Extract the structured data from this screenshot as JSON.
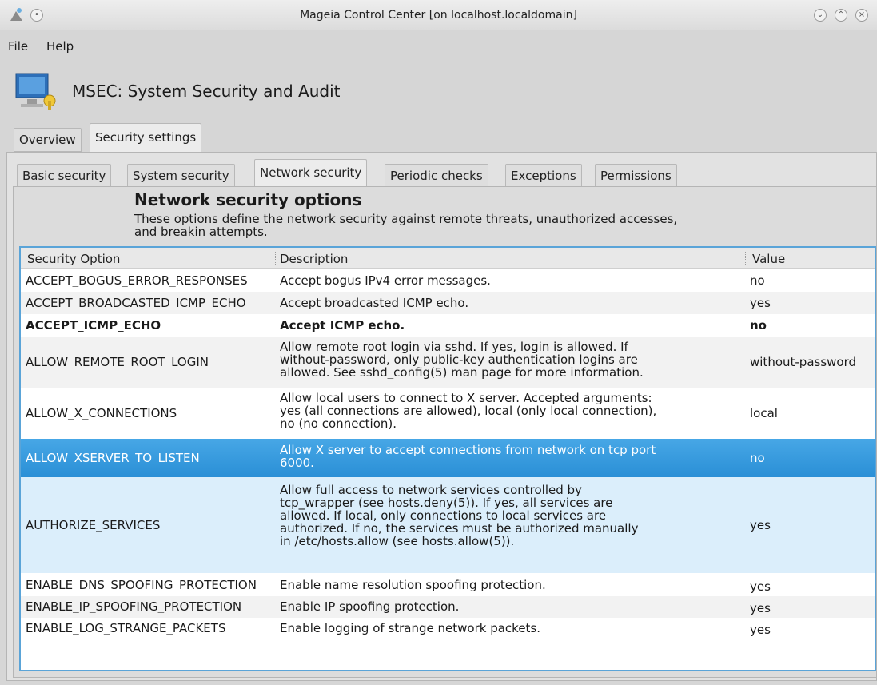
{
  "window": {
    "title": "Mageia Control Center  [on localhost.localdomain]"
  },
  "menu": {
    "file": "File",
    "help": "Help"
  },
  "app": {
    "title": "MSEC: System Security and Audit"
  },
  "top_tabs": [
    "Overview",
    "Security settings"
  ],
  "sub_tabs": [
    "Basic security",
    "System security",
    "Network security",
    "Periodic checks",
    "Exceptions",
    "Permissions"
  ],
  "section": {
    "title": "Network security options",
    "desc_line1": "These options define the network security against remote threats, unauthorized accesses,",
    "desc_line2": "and breakin attempts."
  },
  "table": {
    "headers": [
      "Security Option",
      "Description",
      "Value"
    ],
    "rows": [
      {
        "option": "ACCEPT_BOGUS_ERROR_RESPONSES",
        "desc": [
          "Accept bogus IPv4 error messages."
        ],
        "value": "no"
      },
      {
        "option": "ACCEPT_BROADCASTED_ICMP_ECHO",
        "desc": [
          "Accept broadcasted ICMP echo."
        ],
        "value": "yes"
      },
      {
        "option": "ACCEPT_ICMP_ECHO",
        "desc": [
          "Accept ICMP echo."
        ],
        "value": "no"
      },
      {
        "option": "ALLOW_REMOTE_ROOT_LOGIN",
        "desc": [
          "Allow remote root login via sshd. If yes, login is allowed. If",
          "without-password, only public-key authentication logins are",
          "allowed. See sshd_config(5) man page for more information."
        ],
        "value": "without-password"
      },
      {
        "option": "ALLOW_X_CONNECTIONS",
        "desc": [
          "Allow local users to connect to X server. Accepted arguments:",
          "yes (all connections are allowed), local (only local connection),",
          "no (no connection)."
        ],
        "value": "local"
      },
      {
        "option": "ALLOW_XSERVER_TO_LISTEN",
        "desc": [
          "Allow X server to accept connections from network on tcp port",
          "6000."
        ],
        "value": "no"
      },
      {
        "option": "AUTHORIZE_SERVICES",
        "desc": [
          "Allow full access to network services controlled by",
          "tcp_wrapper (see hosts.deny(5)). If yes, all services are",
          "allowed. If local, only connections to local services are",
          "authorized. If no, the services must be authorized manually",
          "in /etc/hosts.allow (see hosts.allow(5))."
        ],
        "value": "yes"
      },
      {
        "option": "ENABLE_DNS_SPOOFING_PROTECTION",
        "desc": [
          "Enable name resolution spoofing protection."
        ],
        "value": "yes"
      },
      {
        "option": "ENABLE_IP_SPOOFING_PROTECTION",
        "desc": [
          "Enable IP spoofing protection."
        ],
        "value": "yes"
      },
      {
        "option": "ENABLE_LOG_STRANGE_PACKETS",
        "desc": [
          "Enable logging of strange network packets."
        ],
        "value": "yes"
      }
    ]
  },
  "colors": {
    "selection": "#3a9bdc",
    "accent_border": "#5aa4d8",
    "hover_row": "#dbeefb"
  },
  "icons": [
    "mageia-logo-icon",
    "minimize-icon",
    "maximize-icon",
    "close-icon",
    "security-app-icon"
  ]
}
